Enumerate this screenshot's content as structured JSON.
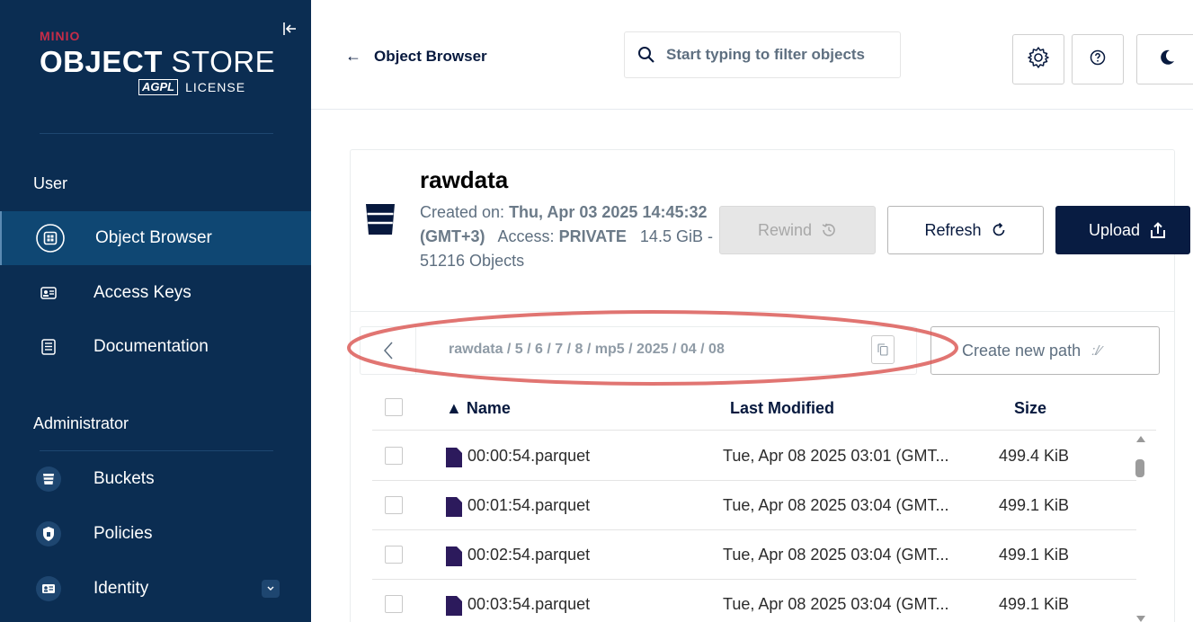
{
  "sidebar": {
    "brand_small": "MINIO",
    "brand_title_bold": "OBJECT",
    "brand_title_light": "STORE",
    "license_logo": "AGPL",
    "license_label": "LICENSE",
    "collapse_icon": "collapse-left-icon",
    "user_section": "User",
    "admin_section": "Administrator",
    "user_items": [
      {
        "label": "Object Browser",
        "icon": "object-browser-icon",
        "active": true
      },
      {
        "label": "Access Keys",
        "icon": "access-keys-icon",
        "active": false
      },
      {
        "label": "Documentation",
        "icon": "documentation-icon",
        "active": false
      }
    ],
    "admin_items": [
      {
        "label": "Buckets",
        "icon": "bucket-icon"
      },
      {
        "label": "Policies",
        "icon": "policy-icon"
      },
      {
        "label": "Identity",
        "icon": "identity-icon"
      }
    ]
  },
  "topbar": {
    "back_label": "Object Browser",
    "search_placeholder": "Start typing to filter objects",
    "buttons": [
      "settings-icon",
      "help-icon",
      "dark-mode-icon"
    ]
  },
  "bucket": {
    "name": "rawdata",
    "created_label": "Created on: ",
    "created_value": "Thu, Apr 03 2025 14:45:32 (GMT+3)",
    "access_label": "Access: ",
    "access_value": "PRIVATE",
    "size_summary": "14.5 GiB - 51216 Objects",
    "rewind_label": "Rewind",
    "refresh_label": "Refresh",
    "upload_label": "Upload"
  },
  "path": {
    "breadcrumb": "rawdata / 5 / 6 / 7 / 8 / mp5 / 2025 / 04 / 08",
    "create_new_path_label": "Create new path"
  },
  "table": {
    "headers": {
      "name": "Name",
      "last_modified": "Last Modified",
      "size": "Size"
    },
    "rows": [
      {
        "name": "00:00:54.parquet",
        "last_modified": "Tue, Apr 08 2025 03:01 (GMT...",
        "size": "499.4 KiB"
      },
      {
        "name": "00:01:54.parquet",
        "last_modified": "Tue, Apr 08 2025 03:04 (GMT...",
        "size": "499.1 KiB"
      },
      {
        "name": "00:02:54.parquet",
        "last_modified": "Tue, Apr 08 2025 03:04 (GMT...",
        "size": "499.1 KiB"
      },
      {
        "name": "00:03:54.parquet",
        "last_modified": "Tue, Apr 08 2025 03:04 (GMT...",
        "size": "499.1 KiB"
      }
    ]
  },
  "colors": {
    "sidebar_bg": "#0b2d52",
    "sidebar_active": "#0f4773",
    "brand_red": "#c72c48",
    "primary_dark": "#081c42",
    "annotation_red": "#d9534f",
    "file_icon": "#2c1a5c"
  }
}
